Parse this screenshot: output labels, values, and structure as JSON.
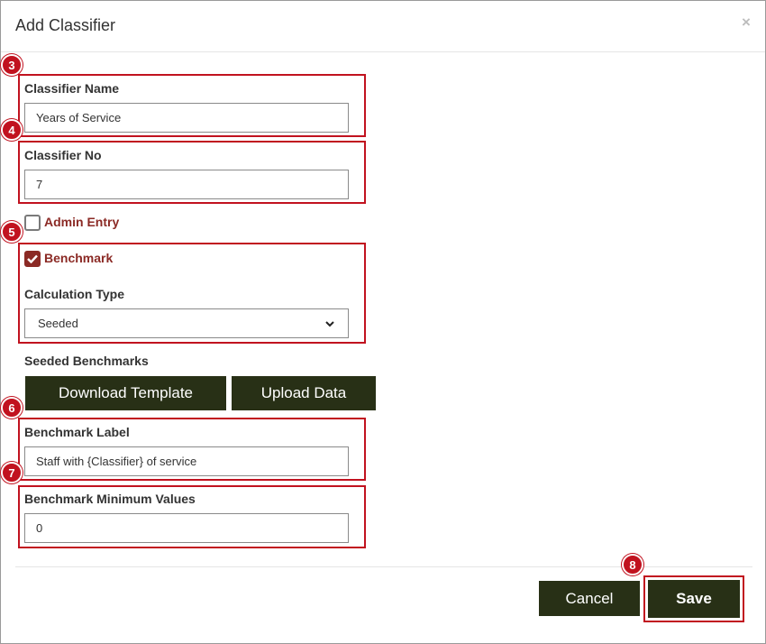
{
  "dialog": {
    "title": "Add Classifier",
    "close_symbol": "×"
  },
  "form": {
    "classifier_name": {
      "label": "Classifier Name",
      "value": "Years of Service"
    },
    "classifier_no": {
      "label": "Classifier No",
      "value": "7"
    },
    "admin_entry": {
      "label": "Admin Entry",
      "checked": false
    },
    "benchmark": {
      "label": "Benchmark",
      "checked": true
    },
    "calculation_type": {
      "label": "Calculation Type",
      "selected": "Seeded"
    },
    "seeded_benchmarks": {
      "label": "Seeded Benchmarks",
      "download_label": "Download Template",
      "upload_label": "Upload Data"
    },
    "benchmark_label": {
      "label": "Benchmark Label",
      "value": "Staff with {Classifier} of service"
    },
    "benchmark_min": {
      "label": "Benchmark Minimum Values",
      "value": "0"
    }
  },
  "footer": {
    "cancel_label": "Cancel",
    "save_label": "Save"
  },
  "annotations": [
    "3",
    "4",
    "5",
    "6",
    "7",
    "8"
  ],
  "colors": {
    "accent": "#c1121f",
    "button": "#283016",
    "checkbox": "#8b2a25"
  }
}
